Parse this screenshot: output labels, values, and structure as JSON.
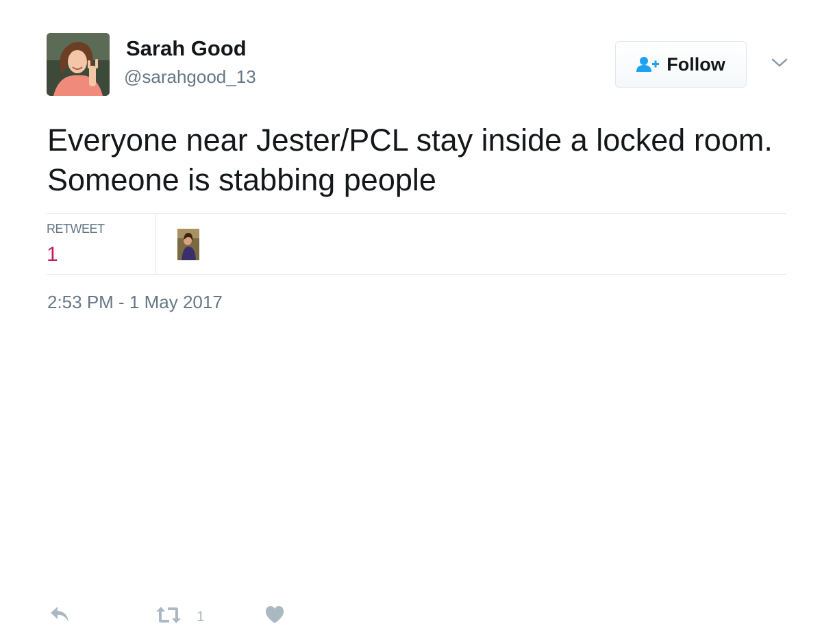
{
  "user": {
    "display_name": "Sarah Good",
    "handle": "@sarahgood_13"
  },
  "follow_button": {
    "label": "Follow",
    "icon": "add-user-icon"
  },
  "menu": {
    "icon": "chevron-down-icon"
  },
  "tweet": {
    "text": "Everyone near Jester/PCL stay inside a locked room. Someone is stabbing people",
    "timestamp": "2:53 PM - 1 May 2017"
  },
  "stats": {
    "retweet_label": "RETWEET",
    "retweet_count": "1"
  },
  "actions": {
    "reply_icon": "reply-icon",
    "retweet_icon": "retweet-icon",
    "retweet_count": "1",
    "like_icon": "heart-icon"
  },
  "colors": {
    "text": "#14171a",
    "secondary_text": "#657786",
    "divider": "#e1e8ed",
    "retweet_count_color": "#c2195d",
    "action_icon": "#aab8c2",
    "follow_icon": "#1da1f2"
  }
}
